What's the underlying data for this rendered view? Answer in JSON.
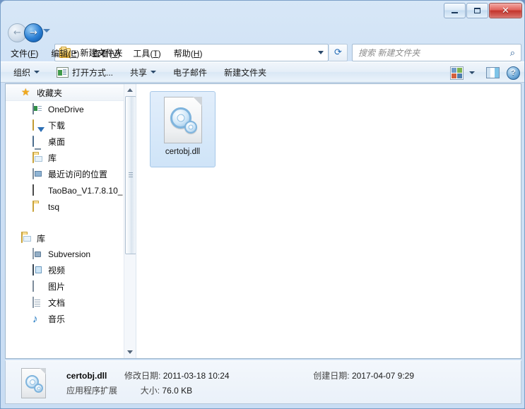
{
  "window": {
    "minimize_label": "最小化",
    "maximize_label": "最大化",
    "close_label": "关闭"
  },
  "navigation": {
    "back_label": "后退",
    "forward_label": "前进",
    "recent_pages_label": "最近的页面",
    "breadcrumb_text": "新建文件夹",
    "breadcrumb_separator": "▸",
    "address_dropdown_label": "历史记录",
    "refresh_icon": "refresh-icon",
    "refresh_glyph": "⟳"
  },
  "search": {
    "placeholder": "搜索 新建文件夹",
    "icon": "search-icon",
    "icon_glyph": "⌕"
  },
  "menubar": {
    "items": [
      {
        "text": "文件",
        "accel": "F"
      },
      {
        "text": "编辑",
        "accel": "E"
      },
      {
        "text": "查看",
        "accel": "V"
      },
      {
        "text": "工具",
        "accel": "T"
      },
      {
        "text": "帮助",
        "accel": "H"
      }
    ]
  },
  "toolbar": {
    "organize_label": "组织",
    "open_with_label": "打开方式...",
    "share_label": "共享",
    "email_label": "电子邮件",
    "new_folder_label": "新建文件夹",
    "view_icon": "view-options-icon",
    "view_dropdown_label": "更改视图",
    "preview_pane_icon": "preview-pane-icon",
    "help_icon": "help-icon",
    "help_glyph": "?"
  },
  "sidebar": {
    "favorites": {
      "label": "收藏夹",
      "icon": "star-icon"
    },
    "favorite_items": [
      {
        "label": "OneDrive",
        "icon": "onedrive-icon"
      },
      {
        "label": "下载",
        "icon": "downloads-icon"
      },
      {
        "label": "桌面",
        "icon": "desktop-icon"
      },
      {
        "label": "库",
        "icon": "library-folder-icon"
      },
      {
        "label": "最近访问的位置",
        "icon": "recent-places-icon"
      },
      {
        "label": "TaoBao_V1.7.8.10_",
        "icon": "taobao-icon"
      },
      {
        "label": "tsq",
        "icon": "folder-icon"
      }
    ],
    "library": {
      "label": "库",
      "icon": "library-folder-icon"
    },
    "library_items": [
      {
        "label": "Subversion",
        "icon": "subversion-icon"
      },
      {
        "label": "视频",
        "icon": "video-icon"
      },
      {
        "label": "图片",
        "icon": "pictures-icon"
      },
      {
        "label": "文档",
        "icon": "documents-icon"
      },
      {
        "label": "音乐",
        "icon": "music-icon"
      }
    ],
    "scrollbar": {
      "up_arrow_label": "向上滚动",
      "down_arrow_label": "向下滚动"
    }
  },
  "files": [
    {
      "name": "certobj.dll",
      "icon": "dll-file-icon",
      "selected": true
    }
  ],
  "statusbar": {
    "file_name": "certobj.dll",
    "file_type": "应用程序扩展",
    "modified_label": "修改日期:",
    "modified_value": "2011-03-18 10:24",
    "created_label": "创建日期:",
    "created_value": "2017-04-07 9:29",
    "size_label": "大小:",
    "size_value": "76.0 KB",
    "icon": "dll-file-icon"
  },
  "colors": {
    "accent": "#2b7fd4",
    "close_button": "#c3352d",
    "selection": "#cfe4f8",
    "frame": "#7ba0c8"
  }
}
